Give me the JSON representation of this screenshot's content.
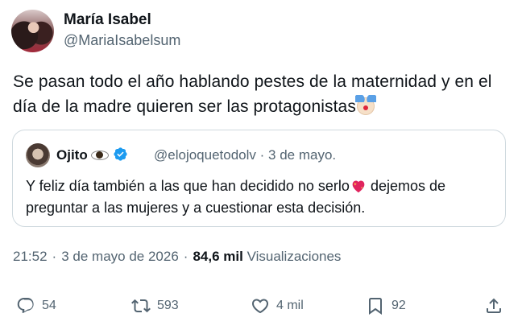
{
  "author": {
    "name": "María Isabel",
    "handle": "@MariaIsabelsum"
  },
  "post": {
    "text": "Se pasan todo el año hablando pestes de la maternidad y en el día de la madre quieren ser las protagonistas",
    "emoji": "clown-face"
  },
  "quoted": {
    "name": "Ojito",
    "name_emoji": "eye",
    "verified": true,
    "handle": "@elojoquetodolv",
    "separator": "·",
    "date": "3 de mayo.",
    "text_part1": "Y feliz día también a las que han decidido no serlo",
    "text_emoji": "sparkling-heart",
    "text_part2": " dejemos de preguntar a las mujeres y a cuestionar esta decisión."
  },
  "meta": {
    "time": "21:52",
    "date": "3 de mayo de 2026",
    "separator": "·",
    "views": "84,6 mil",
    "views_label": "Visualizaciones"
  },
  "actions": {
    "replies": "54",
    "reposts": "593",
    "likes": "4 mil",
    "bookmarks": "92"
  },
  "colors": {
    "text": "#0f1419",
    "secondary": "#536471",
    "border": "#cfd9de",
    "verified": "#1d9bf0"
  }
}
